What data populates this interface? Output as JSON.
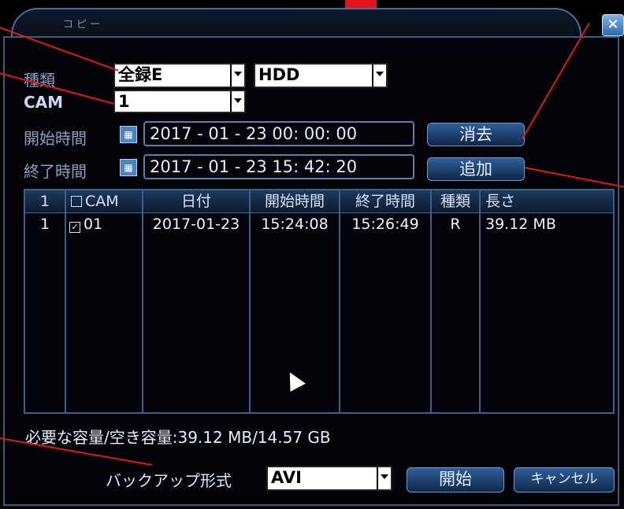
{
  "dialog": {
    "title": "コピー",
    "close": "×"
  },
  "form": {
    "type_label": "種類",
    "type_value": "全録E",
    "storage_value": "HDD",
    "cam_label": "CAM",
    "cam_value": "1",
    "start_label": "開始時間",
    "start_value": "2017 - 01 - 23   00: 00: 00",
    "end_label": "終了時間",
    "end_value": "2017 - 01 - 23   15: 42: 20",
    "delete_button": "消去",
    "add_button": "追加"
  },
  "table": {
    "headers": [
      "1",
      "CAM",
      "日付",
      "開始時間",
      "終了時間",
      "種類",
      "長さ"
    ],
    "rows": [
      {
        "no": "1",
        "cam": "01",
        "date": "2017-01-23",
        "start": "15:24:08",
        "end": "15:26:49",
        "type": "R",
        "length": "39.12 MB"
      }
    ]
  },
  "capacity_text": "必要な容量/空き容量:39.12 MB/14.57 GB",
  "format": {
    "label": "バックアップ形式",
    "value": "AVI"
  },
  "actions": {
    "start": "開始",
    "cancel": "キャンセル"
  },
  "colors": {
    "annotation": "#e2151e",
    "accent": "#3b5b82"
  }
}
